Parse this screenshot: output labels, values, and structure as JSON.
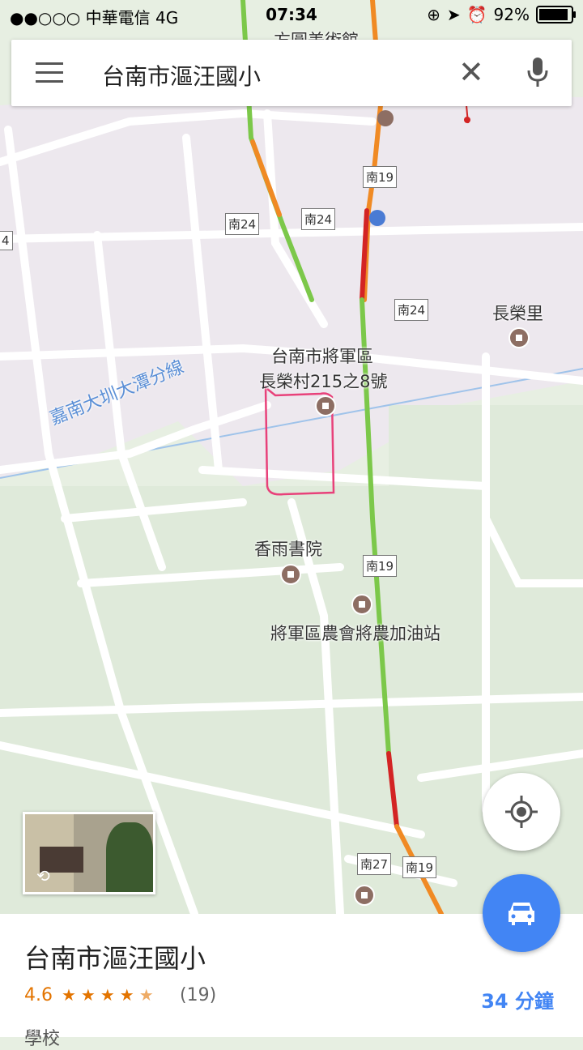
{
  "status_bar": {
    "carrier": "●●○○○ 中華電信   4G",
    "time": "07:34",
    "battery": "92%",
    "battery_level": 0.92
  },
  "search": {
    "query": "台南市漚汪國小",
    "menu_icon": "menu-icon",
    "clear_icon": "close-icon",
    "mic_icon": "mic-icon"
  },
  "map": {
    "labels": {
      "top_museum": "方圓美術館",
      "changrong": "長榮里",
      "address_line1": "台南市將軍區",
      "address_line2": "長榮村215之8號",
      "canal": "嘉南大圳大潭分線",
      "academy": "香雨書院",
      "gas_station": "將軍區農會將農加油站"
    },
    "shields": {
      "nan19_a": "南19",
      "nan24_a": "南24",
      "nan24_b": "南24",
      "nan24_c": "南24",
      "nan19_b": "南19",
      "nan27": "南27",
      "nan19_c": "南19",
      "edge4": "4"
    },
    "colors": {
      "road": "#ffffff",
      "green_area": "#dbe8d3",
      "urban_area": "#ede8ee",
      "traffic_green": "#7cc84a",
      "traffic_orange": "#f08a24",
      "traffic_red": "#d32424",
      "water_label": "#5b8fd6",
      "annotation": "#e8417a"
    }
  },
  "fab": {
    "my_location_icon": "my-location-icon",
    "directions_icon": "car-icon",
    "directions_color": "#4285f4"
  },
  "place": {
    "name": "台南市漚汪國小",
    "rating": "4.6",
    "rating_value": 4.6,
    "reviews": "(19)",
    "travel_time": "34 分鐘",
    "category": "學校"
  }
}
